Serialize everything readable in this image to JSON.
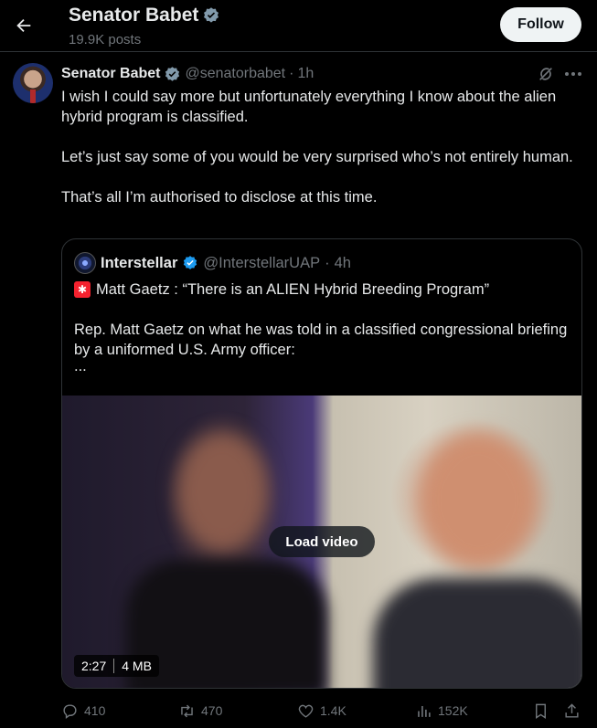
{
  "header": {
    "title": "Senator Babet",
    "posts": "19.9K posts",
    "follow_label": "Follow"
  },
  "tweet": {
    "name": "Senator Babet",
    "handle": "@senatorbabet",
    "dot": "·",
    "time": "1h",
    "paragraphs": [
      "I wish I could say more but unfortunately everything I know about the alien hybrid program is classified.",
      "Let’s just say some of you would be very surprised who’s not entirely human.",
      "That’s all I’m authorised to disclose at this time."
    ]
  },
  "quote": {
    "name": "Interstellar",
    "handle": "@InterstellarUAP",
    "dot": "·",
    "time": "4h",
    "line1": "Matt Gaetz : “There is an ALIEN Hybrid Breeding Program”",
    "line2": "Rep. Matt Gaetz on what he was told in a classified congressional briefing by a uniformed U.S. Army officer:",
    "ellipsis": "...",
    "video": {
      "load_label": "Load video",
      "duration": "2:27",
      "size": "4 MB"
    }
  },
  "actions": {
    "replies": "410",
    "reposts": "470",
    "likes": "1.4K",
    "views": "152K"
  },
  "colors": {
    "background": "#000000",
    "text": "#e7e9ea",
    "muted": "#71767b",
    "verified": "#1d9bf0",
    "border": "#2f3336"
  }
}
